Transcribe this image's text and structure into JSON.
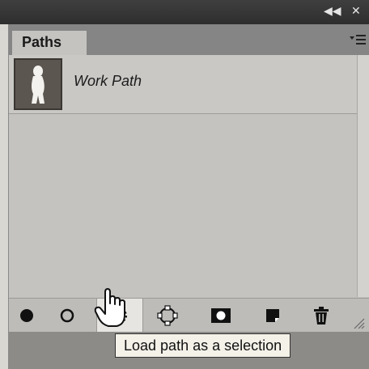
{
  "window": {
    "collapse_label": "◀◀",
    "close_label": "✕"
  },
  "panel": {
    "tab_label": "Paths",
    "menu_icon": "panel-menu-icon",
    "paths": [
      {
        "name": "Work Path",
        "thumbnail": "silhouette-figure"
      }
    ]
  },
  "toolbar": {
    "buttons": [
      {
        "name": "fill-path-icon"
      },
      {
        "name": "stroke-path-icon"
      },
      {
        "name": "load-path-as-selection-icon",
        "active": true
      },
      {
        "name": "make-work-path-icon"
      },
      {
        "name": "add-mask-icon"
      },
      {
        "name": "create-new-path-icon"
      },
      {
        "name": "delete-path-icon"
      }
    ]
  },
  "tooltip": {
    "text": "Load path as a selection"
  }
}
